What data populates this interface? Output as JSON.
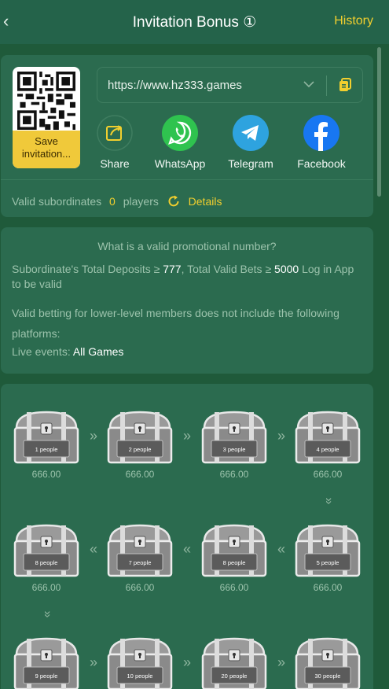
{
  "header": {
    "back_icon": "chevron-left-icon",
    "title": "Invitation Bonus ①",
    "history_label": "History"
  },
  "invite": {
    "qr_icon": "qr-code-icon",
    "save_label": "Save invitation...",
    "url": "https://www.hz333.games",
    "dropdown_icon": "chevron-down-icon",
    "copy_icon": "copy-icon",
    "share_items": [
      {
        "label": "Share",
        "icon": "share-icon"
      },
      {
        "label": "WhatsApp",
        "icon": "whatsapp-icon"
      },
      {
        "label": "Telegram",
        "icon": "telegram-icon"
      },
      {
        "label": "Facebook",
        "icon": "facebook-icon"
      }
    ],
    "valid_label": "Valid subordinates",
    "valid_count": "0",
    "players_label": "players",
    "refresh_icon": "refresh-icon",
    "details_label": "Details"
  },
  "rules": {
    "question": "What is a valid promotional number?",
    "deposit_prefix": "Subordinate's Total Deposits ≥ ",
    "deposit_value": "777",
    "bets_prefix": ",   Total Valid Bets ≥ ",
    "bets_value": "5000",
    "bets_suffix": " Log in App to be valid",
    "platforms_note": "Valid betting for lower-level members does not include the following platforms:",
    "live_label": "Live events: ",
    "live_value": "All Games"
  },
  "chests": [
    {
      "label": "1 people",
      "amount": "666.00"
    },
    {
      "label": "2 people",
      "amount": "666.00"
    },
    {
      "label": "3 people",
      "amount": "666.00"
    },
    {
      "label": "4 people",
      "amount": "666.00"
    },
    {
      "label": "5 people",
      "amount": "666.00"
    },
    {
      "label": "8 people",
      "amount": "666.00"
    },
    {
      "label": "7 people",
      "amount": "666.00"
    },
    {
      "label": "8 people",
      "amount": "666.00"
    },
    {
      "label": "9 people",
      "amount": ""
    },
    {
      "label": "10 people",
      "amount": ""
    },
    {
      "label": "20 people",
      "amount": ""
    },
    {
      "label": "30 people",
      "amount": ""
    }
  ],
  "arrows": {
    "right": "»",
    "left": "«",
    "down": "»"
  },
  "colors": {
    "background": "#1f5a3a",
    "card": "#2b6b4f",
    "accent": "#f2cf2e",
    "muted_text": "#9cc3ac"
  }
}
